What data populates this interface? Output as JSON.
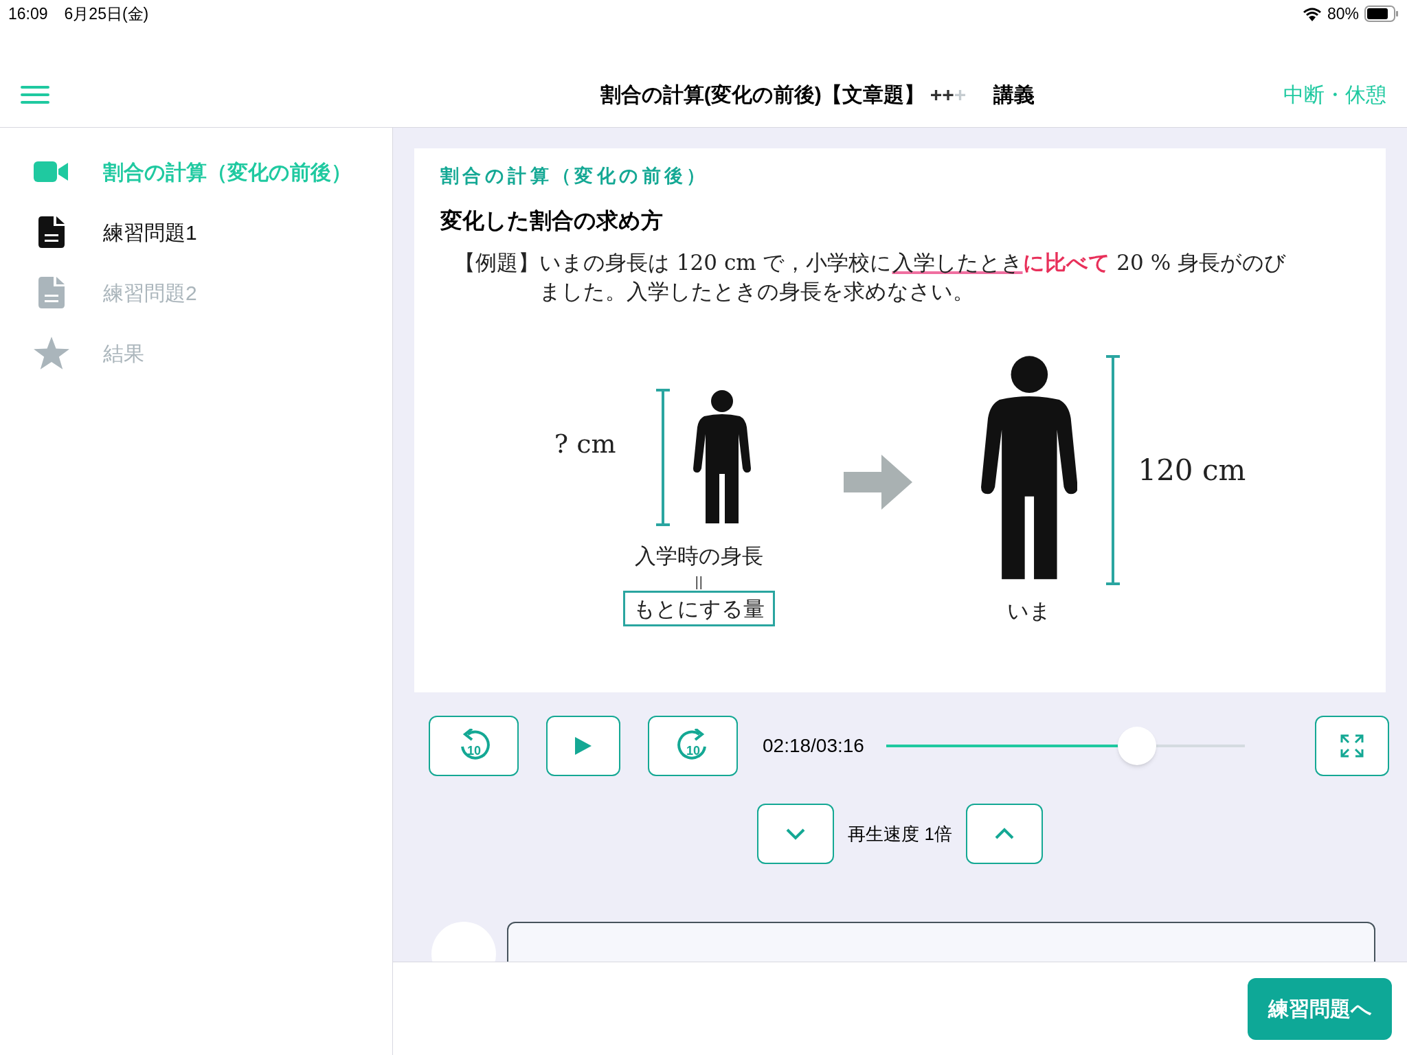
{
  "status_bar": {
    "time": "16:09",
    "date": "6月25日(金)",
    "battery": "80%"
  },
  "header": {
    "title": "割合の計算(変化の前後)【文章題】",
    "marks": [
      {
        "text": "+",
        "on": true
      },
      {
        "text": "+",
        "on": true
      },
      {
        "text": "+",
        "on": false
      }
    ],
    "mode": "講義",
    "action": "中断・休憩"
  },
  "sidebar": {
    "items": [
      {
        "kind": "video",
        "label": "割合の計算（変化の前後）",
        "selected": true,
        "disabled": false
      },
      {
        "kind": "document",
        "label": "練習問題1",
        "selected": false,
        "disabled": false
      },
      {
        "kind": "document",
        "label": "練習問題2",
        "selected": false,
        "disabled": true
      },
      {
        "kind": "result",
        "label": "結果",
        "selected": false,
        "disabled": true
      }
    ]
  },
  "slide": {
    "section": "割合の計算（変化の前後）",
    "heading": "変化した割合の求め方",
    "example_label": "【例題】",
    "example": [
      {
        "kind": "plain",
        "text": "いまの身長は 120 cm で，小学校に"
      },
      {
        "kind": "marked",
        "text": "入学したとき"
      },
      {
        "kind": "key",
        "text": "に比べて"
      },
      {
        "kind": "plain",
        "text": " 20 % 身長がのびました。入学したときの身長を求めなさい。"
      }
    ],
    "before_height": "? cm",
    "before_label": "入学時の身長",
    "equals": "||",
    "base_label": "もとにする量",
    "after_height": "120 cm",
    "after_label": "いま"
  },
  "player": {
    "rewind_label": "10",
    "forward_label": "10",
    "time": "02:18/03:16",
    "level": 0.7,
    "speed": "再生速度 1倍"
  },
  "next_button": "練習問題へ"
}
